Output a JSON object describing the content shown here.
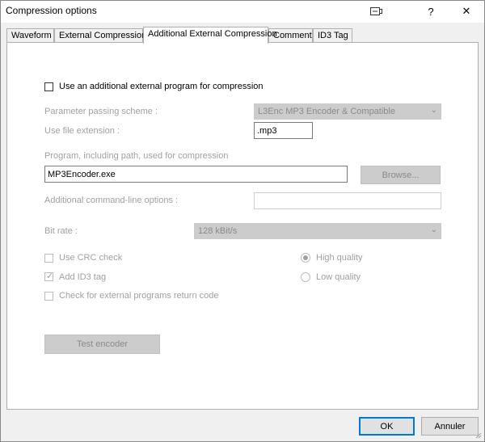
{
  "window": {
    "title": "Compression options",
    "help_label": "?",
    "close_label": "✕"
  },
  "tabs": [
    {
      "label": "Waveform",
      "active": false
    },
    {
      "label": "External Compression",
      "active": false
    },
    {
      "label": "Additional External Compression",
      "active": true
    },
    {
      "label": "Comment",
      "active": false
    },
    {
      "label": "ID3 Tag",
      "active": false
    }
  ],
  "form": {
    "use_additional_label": "Use an additional external program for compression",
    "use_additional_checked": false,
    "param_scheme_label": "Parameter passing scheme :",
    "param_scheme_value": "L3Enc MP3 Encoder & Compatible",
    "file_ext_label": "Use file extension :",
    "file_ext_value": ".mp3",
    "program_label": "Program, including path, used for compression",
    "program_value": "MP3Encoder.exe",
    "browse_label": "Browse...",
    "cmdline_label": "Additional command-line options :",
    "cmdline_value": "",
    "bitrate_label": "Bit rate :",
    "bitrate_value": "128 kBit/s",
    "crc_label": "Use CRC check",
    "crc_checked": false,
    "id3_label": "Add ID3 tag",
    "id3_checked": true,
    "return_code_label": "Check for external programs return code",
    "return_code_checked": false,
    "high_quality_label": "High quality",
    "high_quality_selected": true,
    "low_quality_label": "Low quality",
    "low_quality_selected": false,
    "test_encoder_label": "Test encoder"
  },
  "footer": {
    "ok_label": "OK",
    "cancel_label": "Annuler"
  }
}
